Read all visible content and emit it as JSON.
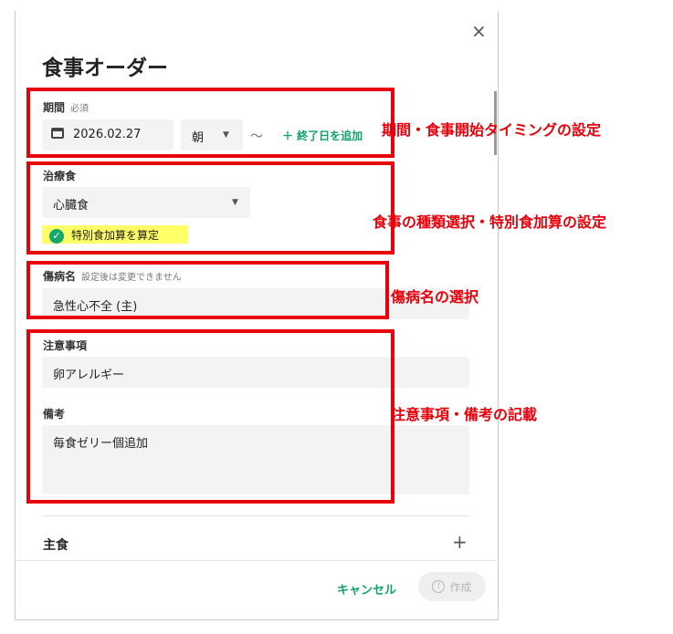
{
  "dialog": {
    "title": "食事オーダー",
    "close_icon": "×"
  },
  "period": {
    "label": "期間",
    "required": "必須",
    "date": "2026.02.27",
    "meal_timing": "朝",
    "tilde": "〜",
    "add_end_date": "＋ 終了日を追加"
  },
  "therapeutic_diet": {
    "label": "治療食",
    "value": "心臓食",
    "special_addition": "特別食加算を算定"
  },
  "disease": {
    "label": "傷病名",
    "note": "設定後は変更できません",
    "value": "急性心不全 (主)"
  },
  "caution": {
    "label": "注意事項",
    "value": "卵アレルギー"
  },
  "remarks": {
    "label": "備考",
    "value": "毎食ゼリー個追加"
  },
  "staple": {
    "label": "主食",
    "add_icon": "+"
  },
  "footer": {
    "cancel": "キャンセル",
    "create": "作成"
  },
  "annotations": {
    "a1": "期間・食事開始タイミングの設定",
    "a2": "食事の種類選択・特別食加算の設定",
    "a3": "傷病名の選択",
    "a4": "注意事項・備考の記載"
  },
  "colors": {
    "accent": "#12a36a",
    "annotation": "#e8000b",
    "highlight": "#ffff66"
  }
}
